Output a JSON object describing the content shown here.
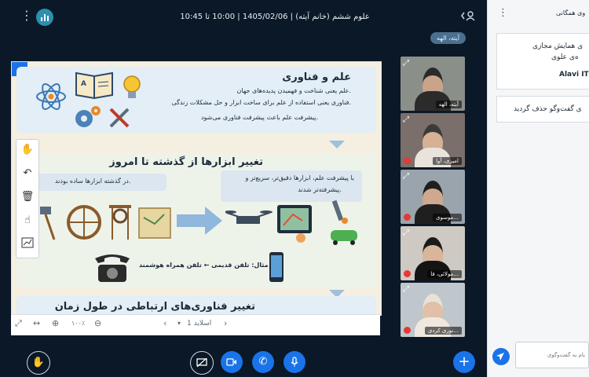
{
  "header": {
    "title": "علوم ششم (خانم آیته) | 1405/02/06 | 10:00 تا 10:45"
  },
  "presenter_tag": "آیته، الهه",
  "slide": {
    "section1": {
      "title": "علم و فناوری",
      "line1": "علم یعنی شناخت و فهمیدن پدیده‌های جهان.",
      "line2": "فناوری یعنی استفاده از علم برای ساخت ابزار و حل مشکلات زندگی.",
      "line3": "پیشرفت علم باعث پیشرفت فناوری می‌شود."
    },
    "section2": {
      "title": "تغییر ابزارها از گذشته تا امروز",
      "past": "در گذشته ابزارها ساده بودند.",
      "now_line1": "با پیشرفت علم، ابزارها دقیق‌تر، سریع‌تر و",
      "now_line2": "پیشرفته‌تر شدند.",
      "example": "مثال: تلفن قدیمی ← تلفن همراه هوشمند"
    },
    "section3": {
      "title": "تغییر فناوری‌های ارتباطی در طول زمان"
    }
  },
  "slide_toolbar": {
    "zoom": "۱۰۰٪",
    "slide_label": "اسلاید 1"
  },
  "webcams": [
    {
      "name": "آیته، الهه",
      "muted": false
    },
    {
      "name": "امیری، آوا",
      "muted": true
    },
    {
      "name": "موسوی...",
      "muted": true
    },
    {
      "name": "مولائی، فا...",
      "muted": true
    },
    {
      "name": "نوری کردی...",
      "muted": true
    }
  ],
  "right_panel": {
    "header": "وی همگانی",
    "card1_line1": "ی همایش مجازی",
    "card1_line2": "ه‌ی علوی",
    "card1_author": "Alavi IT",
    "card2_text": "ی گفت‌وگو حذف گردید",
    "chat_placeholder": "یام به گفت‌وگوی"
  },
  "colors": {
    "background": "#0a1827",
    "accent_blue": "#1a73e8",
    "mute_red": "#e53935",
    "panel": "#f5f6f8"
  }
}
